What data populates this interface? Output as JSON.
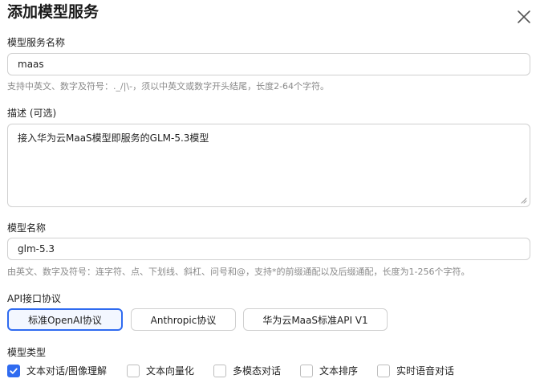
{
  "dialog": {
    "title": "添加模型服务"
  },
  "service_name": {
    "label": "模型服务名称",
    "value": "maas",
    "hint": "支持中英文、数字及符号：._/|\\-，须以中英文或数字开头结尾，长度2-64个字符。"
  },
  "description": {
    "label": "描述 (可选)",
    "value": "接入华为云MaaS模型即服务的GLM-5.3模型"
  },
  "model_name": {
    "label": "模型名称",
    "value": "glm-5.3",
    "hint": "由英文、数字及符号：连字符、点、下划线、斜杠、问号和@，支持*的前缀通配以及后缀通配，长度为1-256个字符。"
  },
  "api_protocol": {
    "label": "API接口协议",
    "options": [
      {
        "label": "标准OpenAI协议",
        "selected": true
      },
      {
        "label": "Anthropic协议",
        "selected": false
      },
      {
        "label": "华为云MaaS标准API V1",
        "selected": false
      }
    ]
  },
  "model_type": {
    "label": "模型类型",
    "options": [
      {
        "label": "文本对话/图像理解",
        "checked": true
      },
      {
        "label": "文本向量化",
        "checked": false
      },
      {
        "label": "多模态对话",
        "checked": false
      },
      {
        "label": "文本排序",
        "checked": false
      },
      {
        "label": "实时语音对话",
        "checked": false
      }
    ]
  },
  "colors": {
    "accent": "#2f6bf0",
    "hint_text": "#8a8a8a",
    "border": "#d0d0d0"
  },
  "icons": {
    "close": "close-icon",
    "check": "checkmark-icon",
    "resize": "resize-grip-icon"
  }
}
